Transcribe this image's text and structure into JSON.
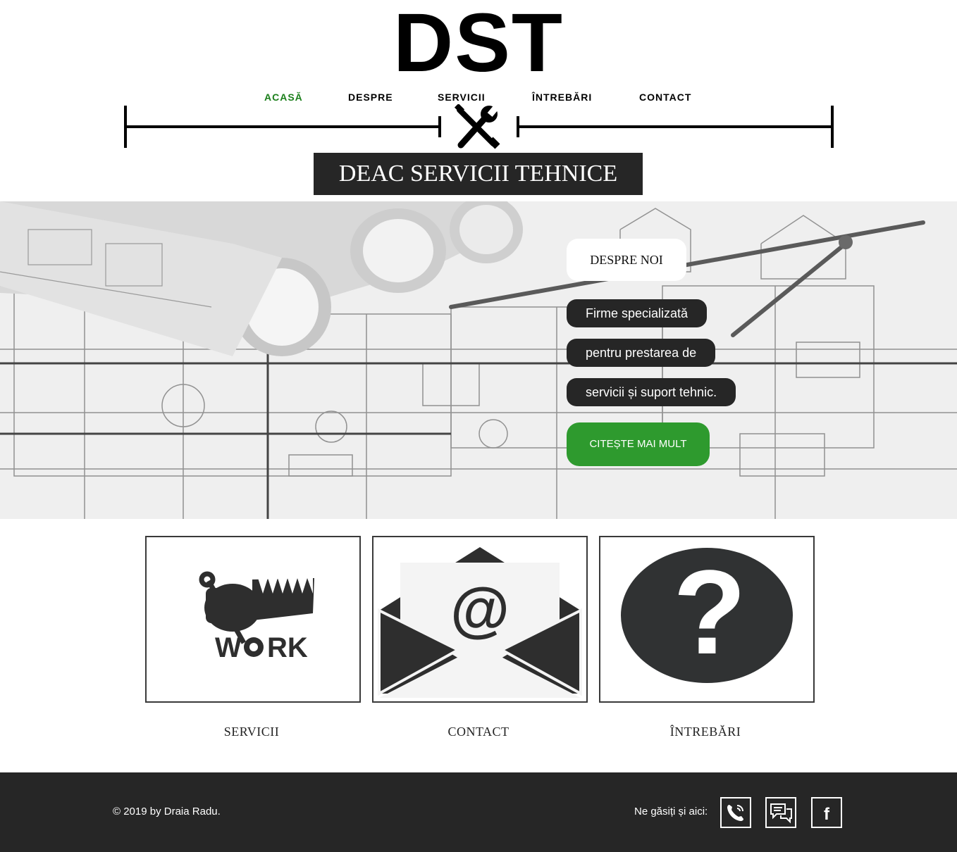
{
  "logo": {
    "text": "DST"
  },
  "nav": {
    "items": [
      {
        "label": "ACASĂ",
        "active": true
      },
      {
        "label": "DESPRE",
        "active": false
      },
      {
        "label": "SERVICII",
        "active": false
      },
      {
        "label": "ÎNTREBĂRI",
        "active": false
      },
      {
        "label": "CONTACT",
        "active": false
      }
    ],
    "active_color": "#1b7f1b"
  },
  "company_name": "DEAC SERVICII TEHNICE",
  "hero": {
    "about_label": "DESPRE NOI",
    "lines": [
      "Firme specializată",
      "pentru prestarea de",
      "servicii și suport tehnic."
    ],
    "cta_label": "CITEȘTE MAI MULT",
    "cta_color": "#2e9a2e",
    "background": "architectural blueprint with rolled plans and compass"
  },
  "cards": [
    {
      "label": "SERVICII",
      "icon": "work-fist-wrench-icon",
      "icon_text": "W",
      "icon_text2": "RK"
    },
    {
      "label": "CONTACT",
      "icon": "email-envelope-icon",
      "icon_text": "@"
    },
    {
      "label": "ÎNTREBĂRI",
      "icon": "question-mark-icon",
      "icon_text": "?"
    }
  ],
  "footer": {
    "copyright": "© 2019 by Draia Radu.",
    "find_us": "Ne găsiți și aici:",
    "social": [
      {
        "icon": "phone-icon"
      },
      {
        "icon": "chat-icon"
      },
      {
        "icon": "facebook-icon",
        "glyph": "f"
      }
    ],
    "background": "#262626"
  }
}
